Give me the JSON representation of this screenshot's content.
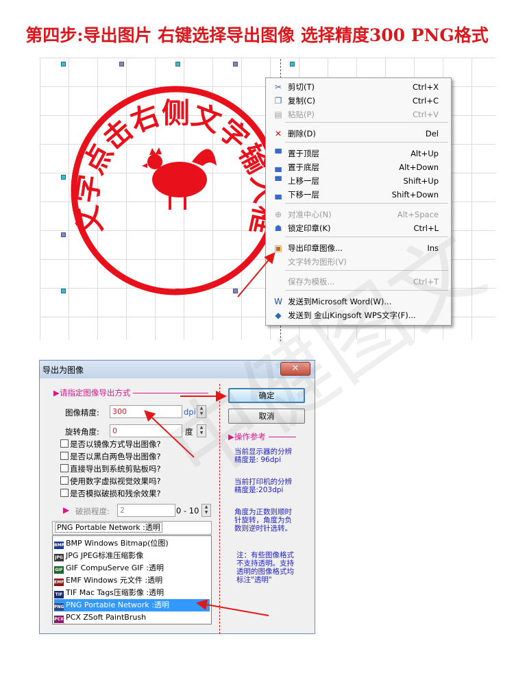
{
  "headline": "第四步:导出图片 右键选择导出图像 选择精度300  PNG格式",
  "seal": {
    "ring_text": "点击文字点击右侧文字输入框修改",
    "color": "#e8101a"
  },
  "context_menu": {
    "items": [
      {
        "icon": "scissors-icon",
        "label": "剪切(T)",
        "shortcut": "Ctrl+X",
        "enabled": true
      },
      {
        "icon": "copy-icon",
        "label": "复制(C)",
        "shortcut": "Ctrl+C",
        "enabled": true
      },
      {
        "icon": "paste-icon",
        "label": "粘贴(P)",
        "shortcut": "Ctrl+V",
        "enabled": false
      },
      {
        "icon": "delete-x-icon",
        "label": "删除(D)",
        "shortcut": "Del",
        "enabled": true
      },
      {
        "icon": "bring-to-front-icon",
        "label": "置于顶层",
        "shortcut": "Alt+Up",
        "enabled": true
      },
      {
        "icon": "send-to-back-icon",
        "label": "置于底层",
        "shortcut": "Alt+Down",
        "enabled": true
      },
      {
        "icon": "move-up-icon",
        "label": "上移一层",
        "shortcut": "Shift+Up",
        "enabled": true
      },
      {
        "icon": "move-down-icon",
        "label": "下移一层",
        "shortcut": "Shift+Down",
        "enabled": true
      },
      {
        "icon": "align-center-icon",
        "label": "对准中心(N)",
        "shortcut": "Alt+Space",
        "enabled": false
      },
      {
        "icon": "lock-seal-icon",
        "label": "锁定印章(K)",
        "shortcut": "Ctrl+L",
        "enabled": true
      },
      {
        "icon": "export-image-icon",
        "label": "导出印章图像...",
        "shortcut": "Ins",
        "enabled": true
      },
      {
        "icon": "",
        "label": "文字转为图形(V)",
        "shortcut": "",
        "enabled": false
      },
      {
        "icon": "",
        "label": "保存为模板...",
        "shortcut": "Ctrl+T",
        "enabled": false
      },
      {
        "icon": "word-icon",
        "label": "发送到Microsoft Word(W)...",
        "shortcut": "",
        "enabled": true
      },
      {
        "icon": "wps-icon",
        "label": "发送到 金山Kingsoft WPS文字(F)...",
        "shortcut": "",
        "enabled": true
      }
    ]
  },
  "dialog": {
    "title": "导出为图像",
    "close_glyph": "✕",
    "section_export": "▶请指定图像导出方式",
    "precision_label": "图像精度:",
    "precision_value": "300",
    "precision_unit": "dpi",
    "rotation_label": "旋转角度:",
    "rotation_value": "0",
    "rotation_unit": "度",
    "checkboxes": [
      {
        "label": "是否以镜像方式导出图像?",
        "checked": false
      },
      {
        "label": "是否以黑白两色导出图像?",
        "checked": false
      },
      {
        "label": "直接导出到系统剪贴板吗?",
        "checked": false
      },
      {
        "label": "使用数字虚拟视觉效果吗?",
        "checked": false
      },
      {
        "label": "是否模拟破损和残余效果?",
        "checked": false
      }
    ],
    "damage_label": "破损程度:",
    "damage_value": "2",
    "damage_range": "0 - 10",
    "format_selected": "PNG Portable Network :透明",
    "formats": [
      {
        "tag": "BMP",
        "color": "#1a3a9a",
        "label": "BMP Windows Bitmap(位图)"
      },
      {
        "tag": "JPG",
        "color": "#3a3a3a",
        "label": "JPG JPEG标准压缩影像"
      },
      {
        "tag": "GIF",
        "color": "#1a6a2a",
        "label": "GIF CompuServe GIF :透明"
      },
      {
        "tag": "EMF",
        "color": "#8a1a1a",
        "label": "EMF Windows 元文件 :透明"
      },
      {
        "tag": "TIF",
        "color": "#1a2a6a",
        "label": "TIF Mac Tags压缩影像 :透明"
      },
      {
        "tag": "PNG",
        "color": "#2a4a8a",
        "label": "PNG Portable Network :透明"
      },
      {
        "tag": "PCX",
        "color": "#8a1a6a",
        "label": "PCX ZSoft PaintBrush"
      }
    ],
    "selected_format_index": 5,
    "ok_label": "确定",
    "cancel_label": "取消",
    "section_ref": "▶操作参考",
    "ref_screen": [
      "当前显示器的分辨",
      "精度是:  96dpi"
    ],
    "ref_printer": [
      "当前打印机的分辨",
      "精度是:203dpi"
    ],
    "ref_angle": [
      "角度为正数则顺时",
      "针旋转，角度为负",
      "数则逆时针选转。"
    ],
    "ref_note": [
      "注：有些图像格式",
      "不支持透明。支持",
      "透明的图像格式均",
      "标注\"透明\""
    ]
  },
  "watermark": "中健图文"
}
